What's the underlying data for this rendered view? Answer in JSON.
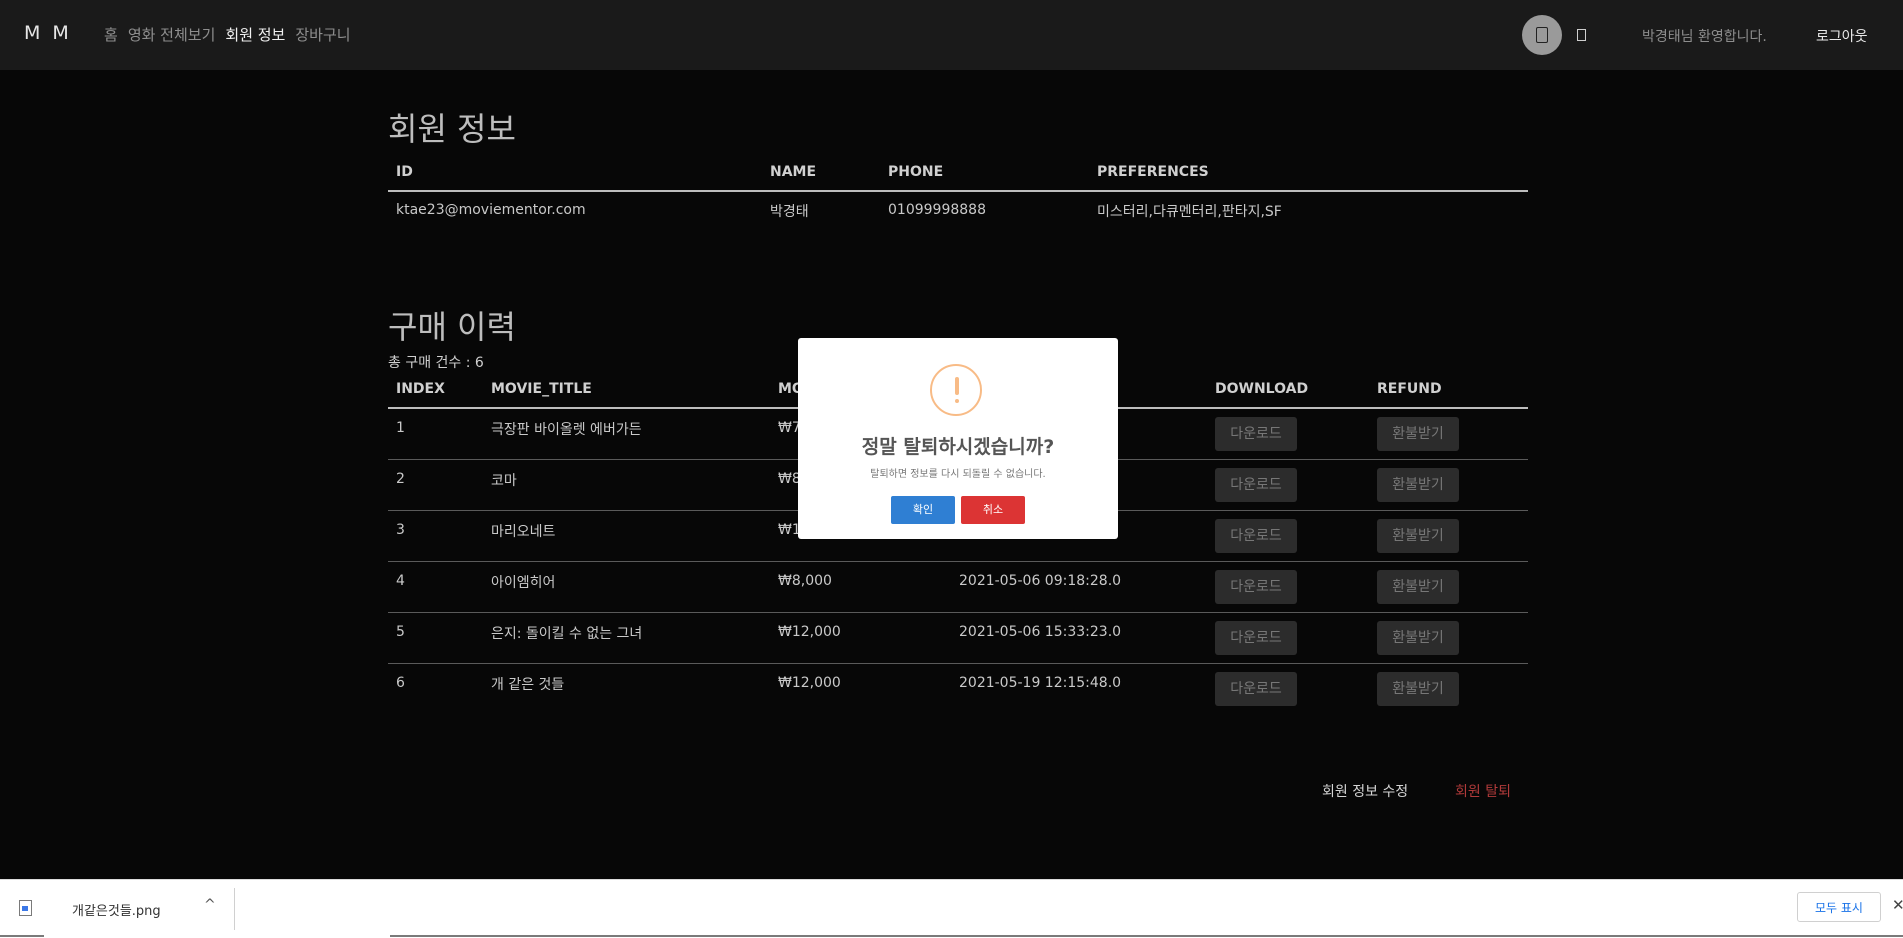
{
  "navbar": {
    "brand": "M M",
    "links": [
      "홈",
      "영화 전체보기",
      "회원 정보",
      "장바구니"
    ],
    "active_link": "회원 정보",
    "welcome": "박경태님 환영합니다.",
    "logout": "로그아웃"
  },
  "member": {
    "title": "회원 정보",
    "headers": [
      "ID",
      "NAME",
      "PHONE",
      "PREFERENCES"
    ],
    "row": [
      "ktae23@moviementor.com",
      "박경태",
      "01099998888",
      "미스터리,다큐멘터리,판타지,SF"
    ]
  },
  "purchases": {
    "title": "구매 이력",
    "count_label": "총 구매 건수 : 6",
    "headers": [
      "INDEX",
      "MOVIE_TITLE",
      "MO",
      "DOWNLOAD",
      "REFUND"
    ],
    "rows": [
      {
        "index": "1",
        "title": "극장판 바이올렛 에버가든",
        "price": "₩7",
        "date": ""
      },
      {
        "index": "2",
        "title": "코마",
        "price": "₩8",
        "date": ""
      },
      {
        "index": "3",
        "title": "마리오네트",
        "price": "₩1",
        "date": ""
      },
      {
        "index": "4",
        "title": "아이엠히어",
        "price": "₩8,000",
        "date": "2021-05-06 09:18:28.0"
      },
      {
        "index": "5",
        "title": "은지: 돌이킬 수 없는 그녀",
        "price": "₩12,000",
        "date": "2021-05-06 15:33:23.0"
      },
      {
        "index": "6",
        "title": "개 같은 것들",
        "price": "₩12,000",
        "date": "2021-05-19 12:15:48.0"
      }
    ],
    "download_label": "다운로드",
    "refund_label": "환불받기"
  },
  "footer": {
    "edit": "회원 정보 수정",
    "withdraw": "회원 탈퇴"
  },
  "modal": {
    "title": "정말 탈퇴하시겠습니까?",
    "text": "탈퇴하면 정보를 다시 되돌릴 수 없습니다.",
    "confirm": "확인",
    "cancel": "취소"
  },
  "download_bar": {
    "filename": "개같은것들.png",
    "show_all": "모두 표시",
    "close": "✕",
    "chevron": "^"
  },
  "colors": {
    "background": "#070707",
    "navbar": "#1a1a1a",
    "withdraw": "#b03a3a",
    "confirm": "#2f7fd3",
    "cancel": "#dc3434",
    "warning": "#f8bb86"
  }
}
